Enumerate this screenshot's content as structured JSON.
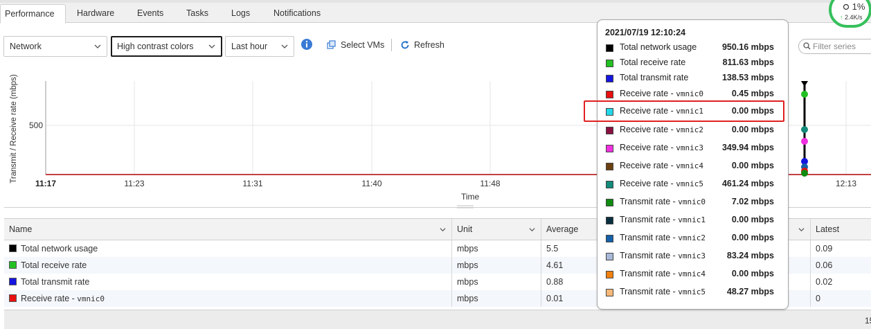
{
  "tabs": [
    {
      "label": "Performance"
    },
    {
      "label": "Hardware"
    },
    {
      "label": "Events"
    },
    {
      "label": "Tasks"
    },
    {
      "label": "Logs"
    },
    {
      "label": "Notifications"
    }
  ],
  "toolbar": {
    "metric_select": "Network",
    "color_select": "High contrast colors",
    "range_select": "Last hour",
    "select_vms_label": "Select VMs",
    "refresh_label": "Refresh",
    "filter_placeholder": "Filter series"
  },
  "status_badge": {
    "percent": "1%",
    "rate": "2.4K/s",
    "color": "#36c05c"
  },
  "chart_data": {
    "type": "line",
    "ylabel": "Transmit / Receive rate (mbps)",
    "xlabel": "Time",
    "y_ticks": [
      "500"
    ],
    "x_ticks": [
      "11:17",
      "11:23",
      "11:31",
      "11:40",
      "11:48",
      "12:13"
    ],
    "spike_time": "12:10:24",
    "series_colors": {
      "total_network": "#000000",
      "total_receive": "#22c022",
      "total_transmit": "#1515e0",
      "receive_vmnic0": "#e81010",
      "receive_vmnic3": "#f030e0",
      "receive_vmnic5": "#138a7a"
    }
  },
  "tooltip": {
    "timestamp": "2021/07/19 12:10:24",
    "rows": [
      {
        "name": "Total network usage",
        "nic": "",
        "value": "950.16 mbps",
        "color": "#000000"
      },
      {
        "name": "Total receive rate",
        "nic": "",
        "value": "811.63 mbps",
        "color": "#22c022"
      },
      {
        "name": "Total transmit rate",
        "nic": "",
        "value": "138.53 mbps",
        "color": "#1515e0"
      },
      {
        "name": "Receive rate - ",
        "nic": "vmnic0",
        "value": "0.45 mbps",
        "color": "#e81010"
      },
      {
        "name": "Receive rate - ",
        "nic": "vmnic1",
        "value": "0.00 mbps",
        "color": "#22d8e8"
      },
      {
        "name": "Receive rate - ",
        "nic": "vmnic2",
        "value": "0.00 mbps",
        "color": "#8a1040"
      },
      {
        "name": "Receive rate - ",
        "nic": "vmnic3",
        "value": "349.94 mbps",
        "color": "#f030e0"
      },
      {
        "name": "Receive rate - ",
        "nic": "vmnic4",
        "value": "0.00 mbps",
        "color": "#6b4010"
      },
      {
        "name": "Receive rate - ",
        "nic": "vmnic5",
        "value": "461.24 mbps",
        "color": "#138a7a"
      },
      {
        "name": "Transmit rate - ",
        "nic": "vmnic0",
        "value": "7.02 mbps",
        "color": "#108a10"
      },
      {
        "name": "Transmit rate - ",
        "nic": "vmnic1",
        "value": "0.00 mbps",
        "color": "#0a3040"
      },
      {
        "name": "Transmit rate - ",
        "nic": "vmnic2",
        "value": "0.00 mbps",
        "color": "#1560a8"
      },
      {
        "name": "Transmit rate - ",
        "nic": "vmnic3",
        "value": "83.24 mbps",
        "color": "#a8b8d8"
      },
      {
        "name": "Transmit rate - ",
        "nic": "vmnic4",
        "value": "0.00 mbps",
        "color": "#f08010"
      },
      {
        "name": "Transmit rate - ",
        "nic": "vmnic5",
        "value": "48.27 mbps",
        "color": "#f8b878"
      }
    ]
  },
  "table": {
    "columns": {
      "name": "Name",
      "unit": "Unit",
      "average": "Average",
      "latest": "Latest"
    },
    "rows": [
      {
        "name": "Total network usage",
        "nic": "",
        "unit": "mbps",
        "average": "5.5",
        "latest": "0.09",
        "color": "#000000"
      },
      {
        "name": "Total receive rate",
        "nic": "",
        "unit": "mbps",
        "average": "4.61",
        "latest": "0.06",
        "color": "#22c022"
      },
      {
        "name": "Total transmit rate",
        "nic": "",
        "unit": "mbps",
        "average": "0.88",
        "latest": "0.02",
        "color": "#1515e0"
      },
      {
        "name": "Receive rate - ",
        "nic": "vmnic0",
        "unit": "mbps",
        "average": "0.01",
        "latest": "0",
        "color": "#e81010"
      }
    ],
    "footer_text": "15"
  }
}
